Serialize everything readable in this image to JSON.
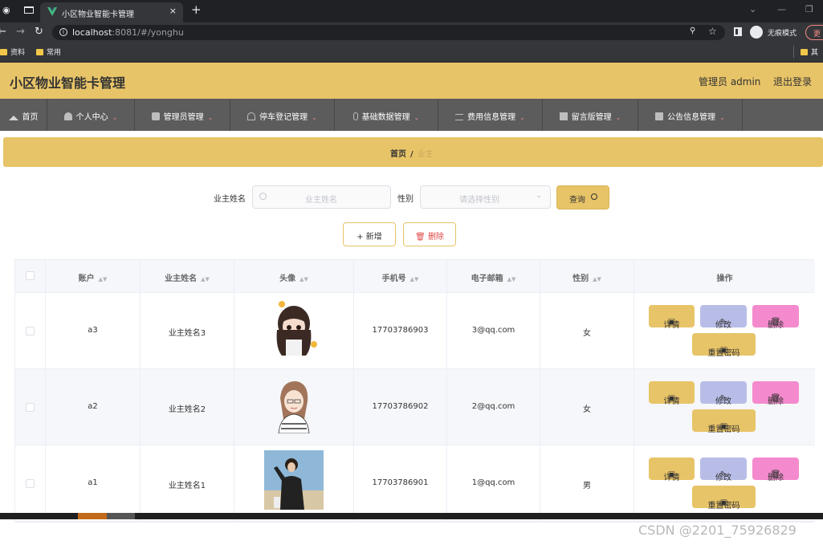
{
  "browser": {
    "tab_title": "小区物业智能卡管理",
    "tab_close": "×",
    "new_tab": "+",
    "url_host": "localhost",
    "url_rest": ":8081/#/yonghu",
    "incognito_label": "无痕模式",
    "update_label": "更",
    "bookmarks": [
      "资料",
      "常用"
    ],
    "bookmark_other": "其"
  },
  "header": {
    "title": "小区物业智能卡管理",
    "admin_text": "管理员 admin",
    "logout": "退出登录"
  },
  "menu": [
    {
      "label": "首页",
      "icon": "home-icon"
    },
    {
      "label": "个人中心",
      "icon": "user-icon"
    },
    {
      "label": "管理员管理",
      "icon": "chat-icon"
    },
    {
      "label": "停车登记管理",
      "icon": "bell-icon"
    },
    {
      "label": "基础数据管理",
      "icon": "mic-icon"
    },
    {
      "label": "费用信息管理",
      "icon": "sliders-icon"
    },
    {
      "label": "留言版管理",
      "icon": "image-icon"
    },
    {
      "label": "公告信息管理",
      "icon": "print-icon"
    }
  ],
  "breadcrumb": {
    "home": "首页",
    "separator": "/",
    "current": "业主"
  },
  "search": {
    "name_label": "业主姓名",
    "name_placeholder": "业主姓名",
    "gender_label": "性别",
    "gender_placeholder": "请选择性别",
    "query_button": "查询"
  },
  "actions": {
    "add": "新增",
    "delete": "删除"
  },
  "table": {
    "headers": [
      "账户",
      "业主姓名",
      "头像",
      "手机号",
      "电子邮箱",
      "性别",
      "操作"
    ],
    "row_actions": {
      "detail": "详情",
      "edit": "修改",
      "delete": "删除",
      "reset": "重置密码"
    },
    "rows": [
      {
        "account": "a3",
        "name": "业主姓名3",
        "phone": "17703786903",
        "email": "3@qq.com",
        "gender": "女"
      },
      {
        "account": "a2",
        "name": "业主姓名2",
        "phone": "17703786902",
        "email": "2@qq.com",
        "gender": "女"
      },
      {
        "account": "a1",
        "name": "业主姓名1",
        "phone": "17703786901",
        "email": "1@qq.com",
        "gender": "男"
      }
    ]
  },
  "watermark": "CSDN @2201_75926829",
  "colors": {
    "accent": "#e8c468",
    "menu_bg": "#5c5c5c",
    "edit": "#b8bde8",
    "delete": "#f48acd"
  }
}
